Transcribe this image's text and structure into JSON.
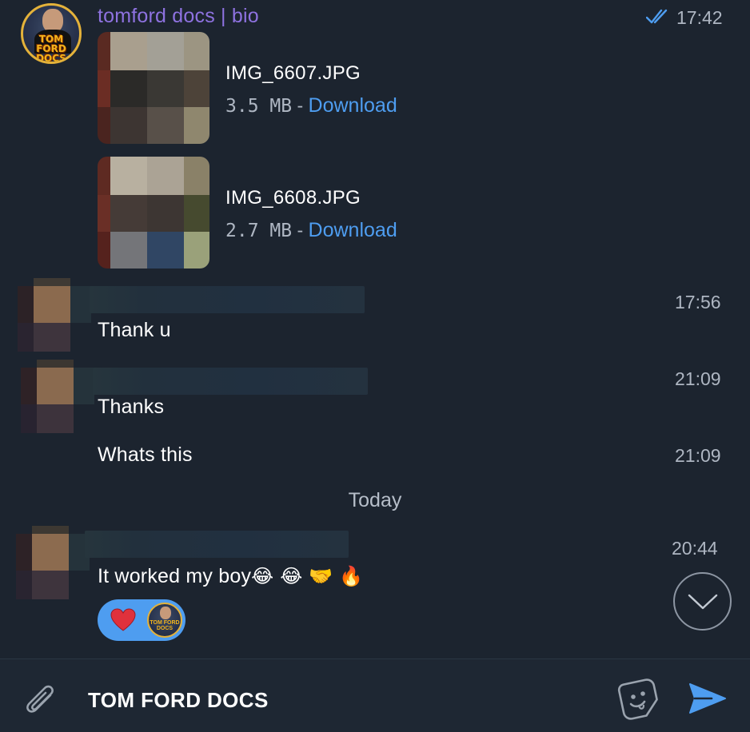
{
  "header": {
    "sender_name": "tomford docs | bio",
    "time": "17:42",
    "avatar_text": "TOM FORD DOCS"
  },
  "files": [
    {
      "name": "IMG_6607.JPG",
      "size": "3.5 MB",
      "separator": " - ",
      "action": "Download"
    },
    {
      "name": "IMG_6608.JPG",
      "size": "2.7 MB",
      "separator": " - ",
      "action": "Download"
    }
  ],
  "messages": [
    {
      "text": "Thank u",
      "time": "17:56"
    },
    {
      "text": "Thanks",
      "time": "21:09"
    },
    {
      "text": "Whats this",
      "time": "21:09"
    }
  ],
  "day_separator": "Today",
  "last_message": {
    "text": "It worked my boy",
    "emojis": "😂 😂 🤝 🔥",
    "time": "20:44"
  },
  "reaction": {
    "emoji_icon": "heart-icon",
    "avatar_text": "TOM FORD DOCS"
  },
  "composer": {
    "value": "TOM FORD DOCS"
  },
  "colors": {
    "background": "#1c242f",
    "accent": "#4e9df0",
    "sender_name": "#8e72e0",
    "muted": "#aeb6c2"
  }
}
